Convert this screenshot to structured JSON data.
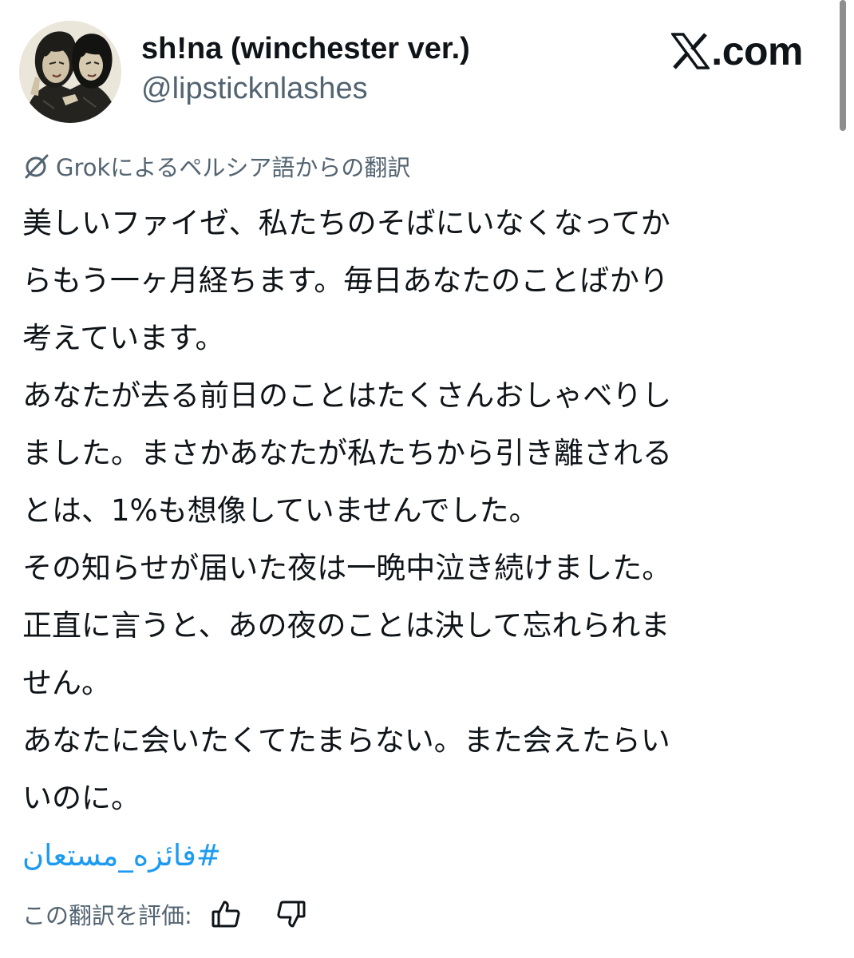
{
  "author": {
    "display_name": "sh!na (winchester ver.)",
    "handle": "@lipsticknlashes"
  },
  "site": {
    "domain": ".com",
    "logo_icon": "x-logo-icon"
  },
  "translation": {
    "icon": "grok-icon",
    "label": "Grokによるペルシア語からの翻訳"
  },
  "tweet": {
    "lines": [
      "美しいファイゼ、私たちのそばにいなくなってか",
      "らもう一ヶ月経ちます。毎日あなたのことばかり",
      "考えています。",
      "あなたが去る前日のことはたくさんおしゃべりし",
      "ました。まさかあなたが私たちから引き離される",
      "とは、1%も想像していませんでした。",
      "その知らせが届いた夜は一晩中泣き続けました。",
      "正直に言うと、あの夜のことは決して忘れられま",
      "せん。",
      "あなたに会いたくてたまらない。また会えたらい",
      "いのに。"
    ],
    "hashtag": "#فائزه_مستعان"
  },
  "rating": {
    "label": "この翻訳を評価:",
    "thumbs_up_icon": "thumbs-up-icon",
    "thumbs_down_icon": "thumbs-down-icon"
  },
  "colors": {
    "text_primary": "#0f1419",
    "text_secondary": "#536471",
    "link": "#1d9bf0",
    "scrollbar": "#8e8e8e"
  }
}
